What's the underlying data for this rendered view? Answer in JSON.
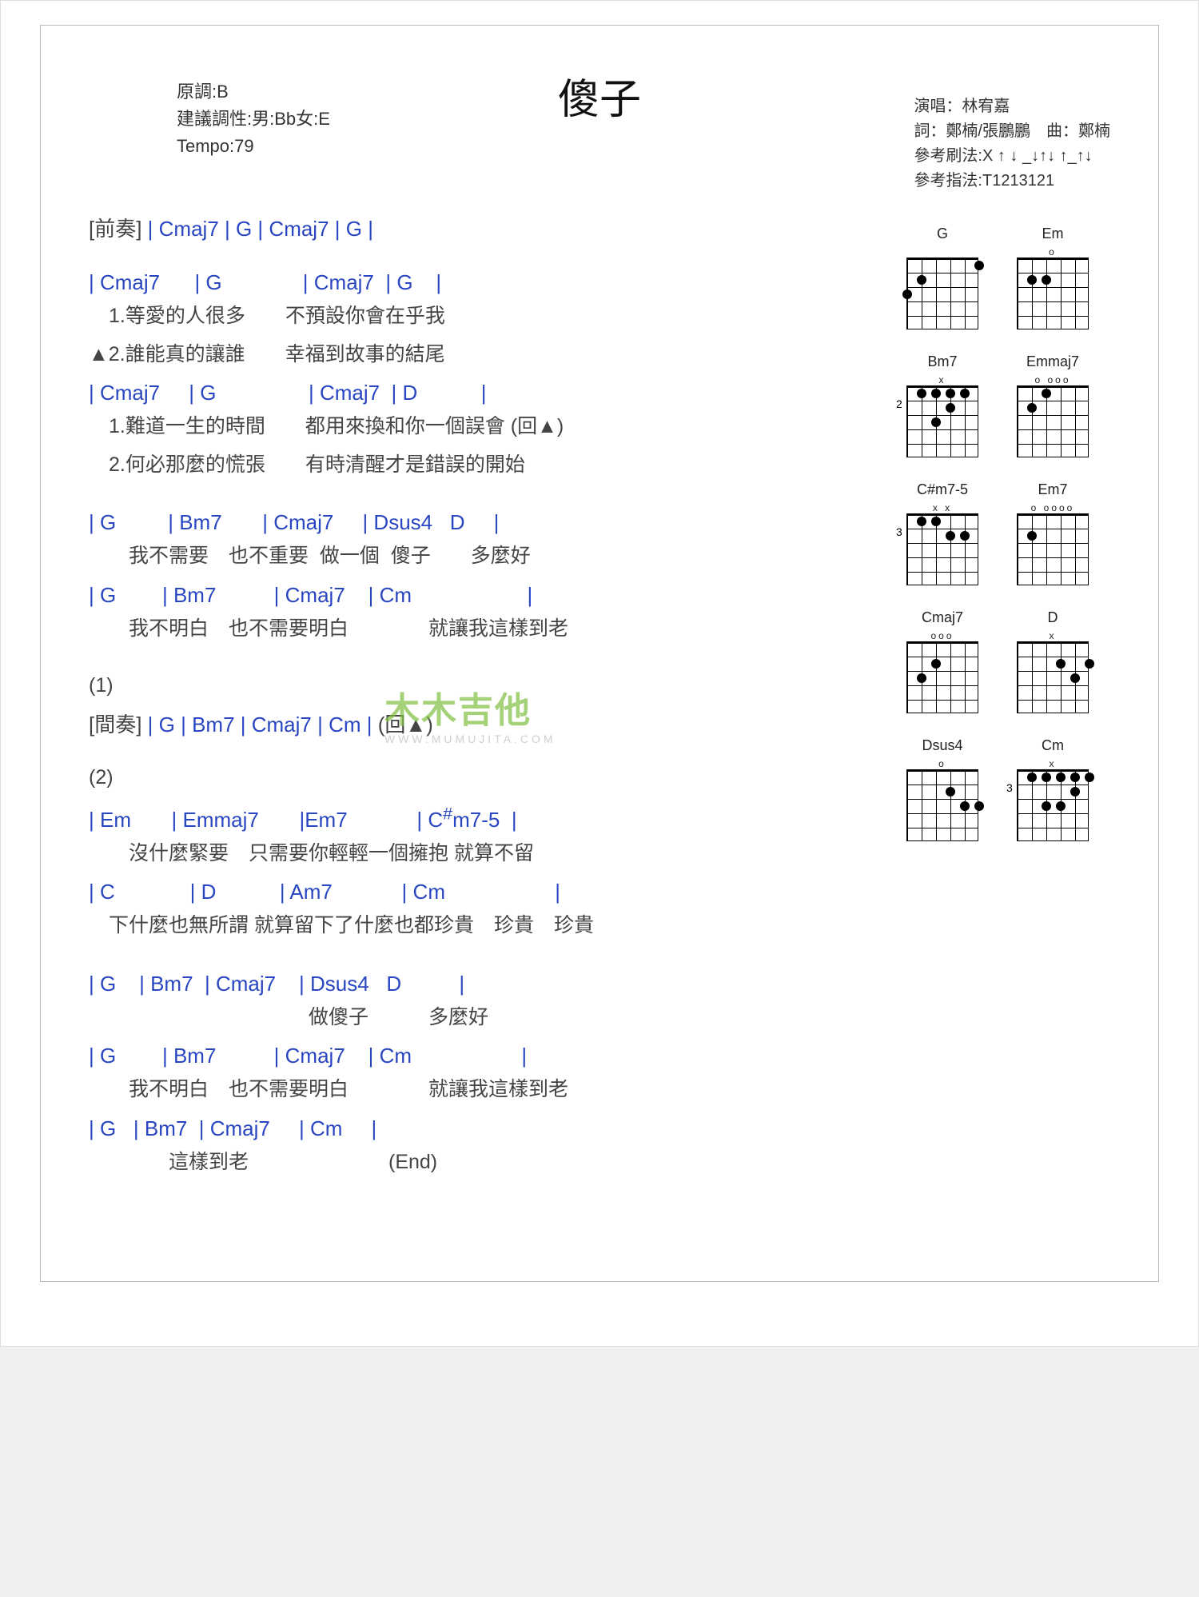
{
  "title": "傻子",
  "meta_left": {
    "key": "原調:B",
    "suggest": "建議調性:男:Bb女:E",
    "tempo": "Tempo:79"
  },
  "meta_right": {
    "singer": "演唱：林宥嘉",
    "writer": "詞：鄭楠/張鵬鵬　曲：鄭楠",
    "strum": "參考刷法:X ↑ ↓ _↓↑↓ ↑_↑↓",
    "finger": "參考指法:T1213121"
  },
  "intro": {
    "tag": "[前奏]",
    "chords": " | Cmaj7 | G | Cmaj7 | G |"
  },
  "block1": {
    "chords1": "| Cmaj7      | G              | Cmaj7  | G    |",
    "lyr1a": "　1.等愛的人很多　　不預設你會在乎我",
    "lyr1b": "▲2.誰能真的讓誰　　幸福到故事的結尾",
    "chords2": "| Cmaj7     | G                | Cmaj7  | D           |",
    "lyr2a": "　1.難道一生的時間　　都用來換和你一個誤會 (回▲)",
    "lyr2b": "　2.何必那麼的慌張　　有時清醒才是錯誤的開始"
  },
  "block2": {
    "chords1": "| G         | Bm7       | Cmaj7     | Dsus4   D     |",
    "lyr1": "　　我不需要　也不重要  做一個  傻子　　多麼好",
    "chords2": "| G        | Bm7          | Cmaj7    | Cm                    |",
    "lyr2": "　　我不明白　也不需要明白　　　　就讓我這樣到老"
  },
  "sec1_label": "(1)",
  "interlude": {
    "tag": "[間奏]",
    "chords": " | G | Bm7 | Cmaj7 | Cm | ",
    "back": "(回▲)"
  },
  "sec2_label": "(2)",
  "block3": {
    "chords1": "| Em       | Emmaj7       |Em7            | C#m7-5  |",
    "ch_sharp": "#",
    "lyr1": "　　沒什麼緊要　只需要你輕輕一個擁抱 就算不留",
    "chords2": "| C             | D           | Am7            | Cm                   |",
    "lyr2": "　下什麼也無所謂 就算留下了什麼也都珍貴　珍貴　珍貴"
  },
  "block4": {
    "chords1": "| G    | Bm7  | Cmaj7    | Dsus4   D          |",
    "lyr1": "　　　　　　　　　　　做傻子　　　多麼好",
    "chords2": "| G        | Bm7          | Cmaj7    | Cm                   |",
    "lyr2": "　　我不明白　也不需要明白　　　　就讓我這樣到老",
    "chords3": "| G   | Bm7  | Cmaj7     | Cm     |",
    "lyr3": "　　　　這樣到老　　　　　　　(End)"
  },
  "watermark": {
    "text": "木木吉他",
    "url": "WWW.MUMUJITA.COM"
  },
  "chord_diagrams": [
    {
      "name": "G",
      "top": "",
      "fret": "",
      "dots": [
        [
          1,
          18
        ],
        [
          5,
          36
        ],
        [
          6,
          54
        ]
      ]
    },
    {
      "name": "Em",
      "top": "o",
      "fret": "",
      "dots": [
        [
          4,
          36
        ],
        [
          5,
          36
        ]
      ]
    },
    {
      "name": "Bm7",
      "top": "x",
      "fret": "2",
      "dots": [
        [
          2,
          18
        ],
        [
          3,
          18
        ],
        [
          4,
          18
        ],
        [
          5,
          18
        ],
        [
          3,
          36
        ],
        [
          4,
          54
        ]
      ]
    },
    {
      "name": "Emmaj7",
      "top": "o      ooo",
      "fret": "",
      "dots": [
        [
          5,
          36
        ],
        [
          4,
          18
        ]
      ]
    },
    {
      "name": "C#m7-5",
      "top": "x        x",
      "fret": "3",
      "dots": [
        [
          2,
          36
        ],
        [
          3,
          36
        ],
        [
          4,
          18
        ],
        [
          5,
          18
        ]
      ]
    },
    {
      "name": "Em7",
      "top": "o   oooo",
      "fret": "",
      "dots": [
        [
          5,
          36
        ]
      ]
    },
    {
      "name": "Cmaj7",
      "top": "   ooo",
      "fret": "",
      "dots": [
        [
          5,
          54
        ],
        [
          4,
          36
        ]
      ]
    },
    {
      "name": "D",
      "top": "x",
      "fret": "",
      "dots": [
        [
          1,
          36
        ],
        [
          2,
          54
        ],
        [
          3,
          36
        ]
      ]
    },
    {
      "name": "Dsus4",
      "top": "   o",
      "fret": "",
      "dots": [
        [
          1,
          54
        ],
        [
          2,
          54
        ],
        [
          3,
          36
        ]
      ]
    },
    {
      "name": "Cm",
      "top": "x",
      "fret": "3",
      "dots": [
        [
          1,
          18
        ],
        [
          2,
          18
        ],
        [
          3,
          18
        ],
        [
          4,
          18
        ],
        [
          5,
          18
        ],
        [
          2,
          36
        ],
        [
          3,
          54
        ],
        [
          4,
          54
        ]
      ]
    }
  ]
}
